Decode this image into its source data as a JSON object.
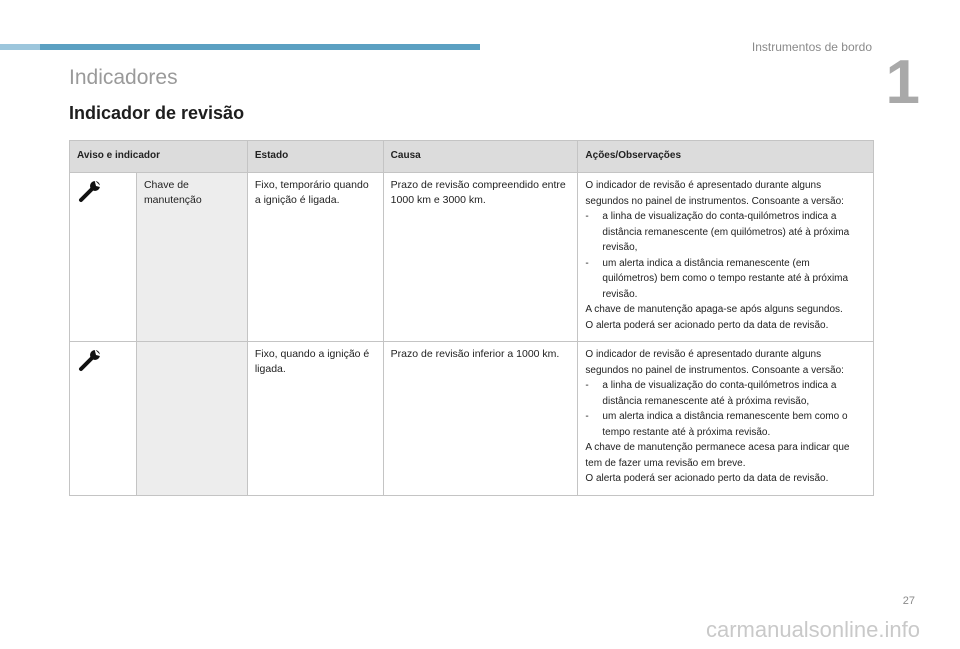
{
  "header": {
    "chapter_title": "Instrumentos de bordo",
    "chapter_number": "1",
    "section_title": "Indicadores",
    "page_heading": "Indicador de revisão"
  },
  "table": {
    "columns": [
      "Aviso e indicador",
      "Estado",
      "Causa",
      "Ações/Observações"
    ],
    "rows": [
      {
        "icon": "wrench-icon",
        "name": "Chave de manutenção",
        "state": "Fixo, temporário quando a ignição é ligada.",
        "cause": "Prazo de revisão compreendido entre 1000 km e 3000 km.",
        "notes": {
          "intro": "O indicador de revisão é apresentado durante alguns segundos no painel de instrumentos. Consoante a versão:",
          "bullets": [
            "a linha de visualização do conta-quilómetros indica a distância remanescente (em quilómetros) até à próxima revisão,",
            "um alerta indica a distância remanescente (em quilómetros) bem como o tempo restante até à próxima revisão."
          ],
          "after": [
            "A chave de manutenção apaga-se após alguns segundos.",
            "O alerta poderá ser acionado perto da data de revisão."
          ]
        }
      },
      {
        "icon": "wrench-icon",
        "name": "",
        "state": "Fixo, quando a ignição é ligada.",
        "cause": "Prazo de revisão inferior a 1000 km.",
        "notes": {
          "intro": "O indicador de revisão é apresentado durante alguns segundos no painel de instrumentos. Consoante a versão:",
          "bullets": [
            "a linha de visualização do conta-quilómetros indica a distância remanescente até à próxima revisão,",
            "um alerta indica a distância remanescente bem como o tempo restante até à próxima revisão."
          ],
          "after": [
            "A chave de manutenção permanece acesa para indicar que tem de fazer uma revisão em breve.",
            "O alerta poderá ser acionado perto da data de revisão."
          ]
        }
      }
    ]
  },
  "footer": {
    "page_number": "27",
    "watermark": "carmanualsonline.info"
  }
}
